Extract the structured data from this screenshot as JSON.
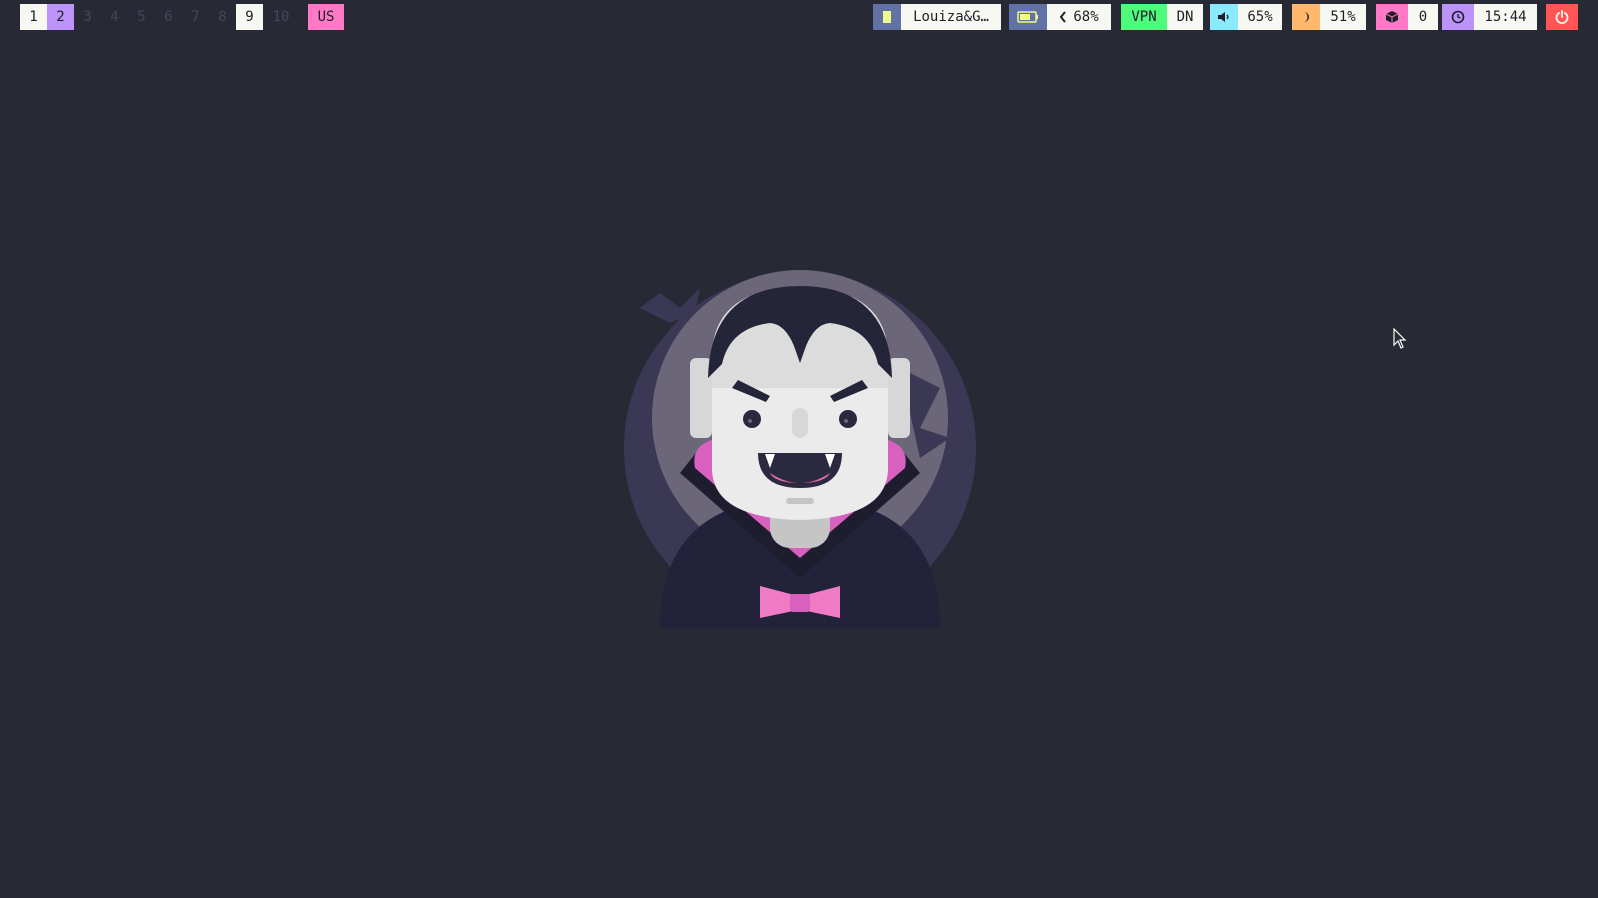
{
  "workspaces": [
    "1",
    "2",
    "3",
    "4",
    "5",
    "6",
    "7",
    "8",
    "9",
    "10"
  ],
  "focused_workspace": "1",
  "active_workspace": "2",
  "keyboard_layout": "US",
  "modules": {
    "window_title": "Louiza&G…",
    "battery": "68%",
    "vpn": {
      "label": "VPN",
      "status": "DN"
    },
    "volume": "65%",
    "brightness": "51%",
    "updates": "0",
    "clock": "15:44"
  },
  "colors": {
    "background": "#272935",
    "workspace_active": "#bd93f9",
    "layout": "#ff79c6",
    "title_icon_bg": "#6272a4",
    "battery_icon_bg": "#6272a4",
    "vpn_bg": "#50fa7b",
    "volume_icon_bg": "#8be9fd",
    "brightness_icon_bg": "#ffb86c",
    "updates_icon_bg": "#ff79c6",
    "clock_icon_bg": "#bd93f9",
    "power_bg": "#ff5555"
  },
  "icons": {
    "window": "window-icon",
    "battery": "battery-icon",
    "charging": "chevron-left-icon",
    "volume": "speaker-icon",
    "brightness": "moon-icon",
    "updates": "package-icon",
    "clock": "clock-icon",
    "power": "power-icon"
  }
}
